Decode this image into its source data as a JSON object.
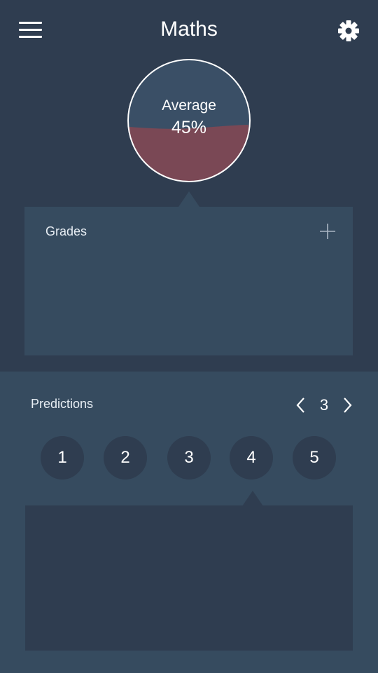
{
  "header": {
    "title": "Maths",
    "menu_icon": "hamburger-menu-icon",
    "settings_icon": "gear-icon"
  },
  "average": {
    "label": "Average",
    "value_text": "45%",
    "fill_fraction": 0.45,
    "fill_color": "#7a4855",
    "empty_color": "#3a4f66"
  },
  "grades": {
    "title": "Grades",
    "add_icon": "plus-icon"
  },
  "predictions": {
    "title": "Predictions",
    "page": "3",
    "prev_icon": "chevron-left-icon",
    "next_icon": "chevron-right-icon",
    "options": [
      "1",
      "2",
      "3",
      "4",
      "5"
    ],
    "selected_index": 3
  },
  "colors": {
    "background_dark": "#2f3d50",
    "background_light": "#364b5f"
  }
}
